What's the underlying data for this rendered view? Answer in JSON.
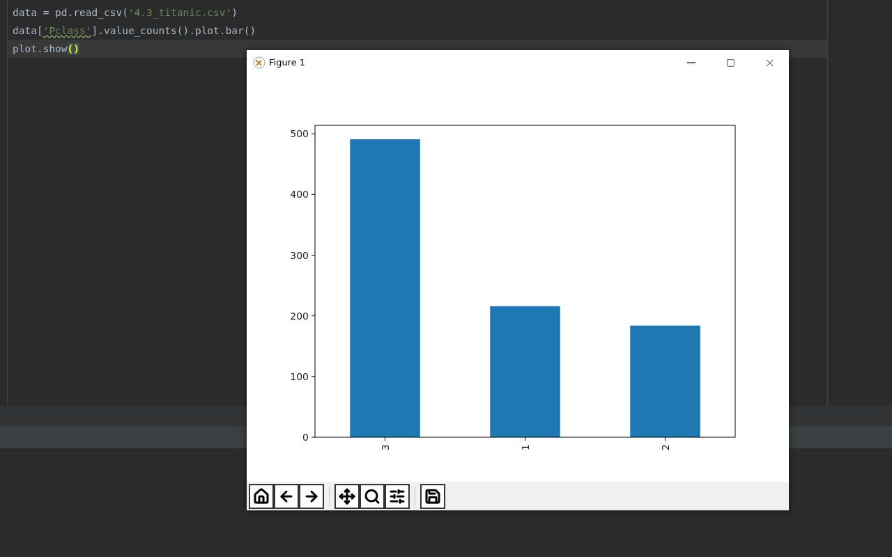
{
  "editor": {
    "lines": [
      {
        "current": false,
        "tokens": [
          {
            "kind": "plain",
            "text": "data = pd.read_csv("
          },
          {
            "kind": "string",
            "text": "'4.3_titanic.csv'"
          },
          {
            "kind": "plain",
            "text": ")"
          }
        ]
      },
      {
        "current": false,
        "tokens": [
          {
            "kind": "plain",
            "text": "data["
          },
          {
            "kind": "string-warned",
            "text": "'Pclass'"
          },
          {
            "kind": "plain",
            "text": "].value_counts().plot.bar()"
          }
        ]
      },
      {
        "current": true,
        "tokens": [
          {
            "kind": "plain",
            "text": "plot.show"
          },
          {
            "kind": "brace-match",
            "text": "()"
          }
        ]
      }
    ]
  },
  "figure_window": {
    "title": "Figure 1",
    "chart_data": {
      "type": "bar",
      "categories": [
        "3",
        "1",
        "2"
      ],
      "values": [
        491,
        216,
        184
      ],
      "ylim": [
        0,
        514
      ],
      "yticks": [
        0,
        100,
        200,
        300,
        400,
        500
      ]
    },
    "toolbar": [
      {
        "kind": "home"
      },
      {
        "kind": "back"
      },
      {
        "kind": "forward"
      },
      {
        "kind": "separator"
      },
      {
        "kind": "pan"
      },
      {
        "kind": "zoom"
      },
      {
        "kind": "configure"
      },
      {
        "kind": "separator"
      },
      {
        "kind": "save"
      }
    ]
  }
}
